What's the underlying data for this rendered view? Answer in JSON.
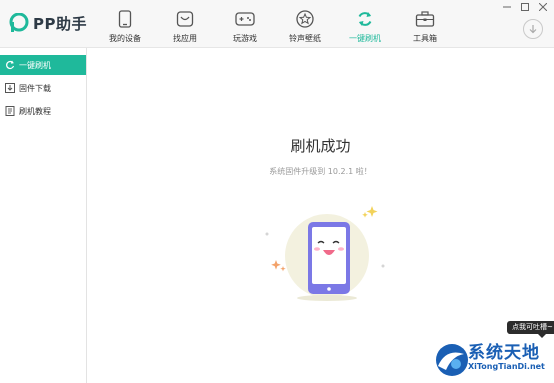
{
  "app": {
    "name": "PP助手"
  },
  "nav": {
    "items": [
      {
        "label": "我的设备",
        "icon": "phone-icon"
      },
      {
        "label": "找应用",
        "icon": "app-store-icon"
      },
      {
        "label": "玩游戏",
        "icon": "gamepad-icon"
      },
      {
        "label": "铃声壁纸",
        "icon": "star-icon"
      },
      {
        "label": "一键刷机",
        "icon": "refresh-icon",
        "active": true
      },
      {
        "label": "工具箱",
        "icon": "toolbox-icon"
      }
    ]
  },
  "sidebar": {
    "items": [
      {
        "label": "一键刷机",
        "icon": "refresh-icon",
        "active": true
      },
      {
        "label": "固件下载",
        "icon": "download-icon"
      },
      {
        "label": "刷机教程",
        "icon": "book-icon"
      }
    ]
  },
  "main": {
    "title": "刷机成功",
    "subtitle": "系统固件升级到 10.2.1 啦！"
  },
  "tooltip": {
    "text": "点我可吐槽~"
  },
  "watermark": {
    "title": "系统天地",
    "url": "XiTongTianDi.net"
  },
  "colors": {
    "accent": "#1fb99b",
    "phone": "#7b78e6"
  }
}
